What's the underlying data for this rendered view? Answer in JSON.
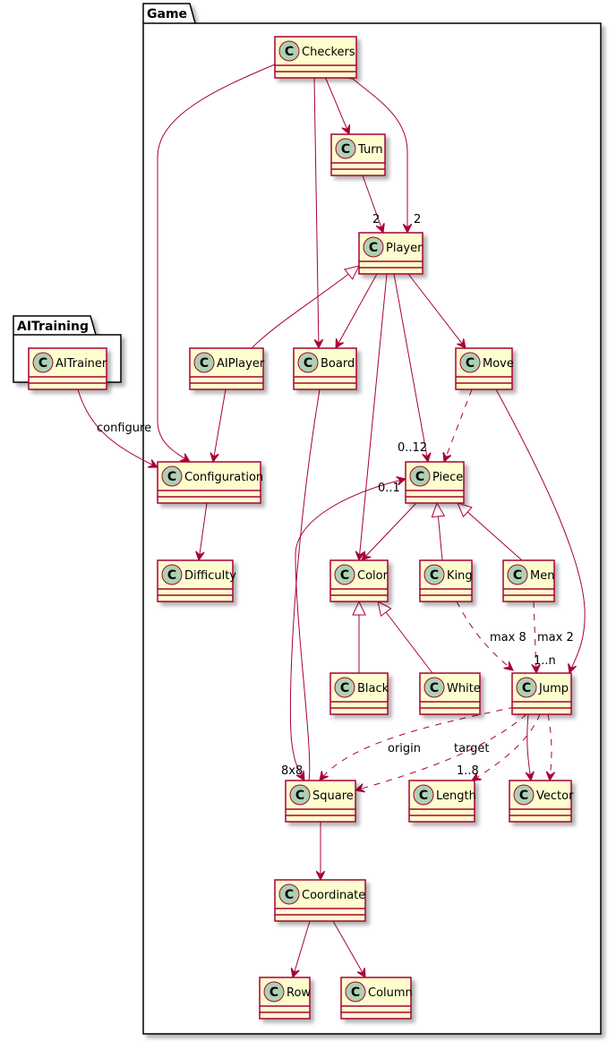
{
  "packages": {
    "game": "Game",
    "ai_training": "AITraining"
  },
  "classes": {
    "checkers": "Checkers",
    "turn": "Turn",
    "player": "Player",
    "aiplayer": "AIPlayer",
    "board": "Board",
    "move": "Move",
    "aitrainer": "AITrainer",
    "configuration": "Configuration",
    "piece": "Piece",
    "difficulty": "Difficulty",
    "color": "Color",
    "king": "King",
    "men": "Men",
    "black": "Black",
    "white": "White",
    "jump": "Jump",
    "square": "Square",
    "length": "Length",
    "vector": "Vector",
    "coordinate": "Coordinate",
    "row": "Row",
    "column": "Column"
  },
  "class_icon_letter": "C",
  "labels": {
    "checkers_player_mult": "2",
    "turn_player_mult": "2",
    "configure": "configure",
    "player_piece_mult": "0..12",
    "square_piece_mult": "0..1",
    "board_square_mult": "8x8",
    "king_jump": "max 8",
    "men_jump": "max 2",
    "jump_mult": "1..n",
    "origin": "origin",
    "target": "target",
    "length_mult": "1..8"
  },
  "colors": {
    "border": "#A80036",
    "class_fill": "#FEFECE",
    "icon_fill": "#ADD1B2"
  }
}
